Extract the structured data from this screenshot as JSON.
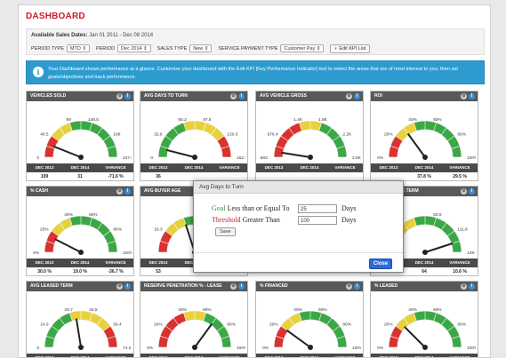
{
  "page": {
    "title": "DASHBOARD"
  },
  "filters": {
    "available_label": "Available Sales Dates:",
    "available_range": "Jan 01 2011 - Dec 08 2014",
    "period_type_label": "PERIOD TYPE",
    "period_type_value": "MTD",
    "period_label": "PERIOD",
    "period_value": "Dec 2014",
    "sales_type_label": "SALES TYPE",
    "sales_type_value": "New",
    "service_payment_type_label": "SERVICE PAYMENT TYPE",
    "service_payment_type_value": "Customer Pay",
    "edit_kpi_label": "Edit KPI List"
  },
  "info": {
    "icon": "info-icon",
    "text": "Your Dashboard shows performance at a glance. Customize your dashboard with the Edit KPI [Key Performance Indicator] tool to select the areas that are of most interest to you; then set goals/objectives and track performance."
  },
  "colors": {
    "accent": "#c8202b",
    "info_bg": "#2e9bcf",
    "header_bg": "#595959",
    "green": "#3aa845",
    "yellow": "#e8d13a",
    "red": "#d9322f"
  },
  "footer_labels": [
    "DEC 2013",
    "DEC 2014",
    "VARIANCE"
  ],
  "cards": [
    {
      "title": "VEHICLES SOLD",
      "ticks": [
        "0",
        "49.5",
        "99",
        "148.5",
        "198",
        "247.5"
      ],
      "tick_display": [
        "0",
        "49.5",
        "99",
        "148.5",
        "198",
        "247.5"
      ],
      "needle": 0.12,
      "scheme": "gyg",
      "values": [
        "109",
        "31",
        "-71.6 %"
      ]
    },
    {
      "title": "AVG DAYS TO TURN",
      "ticks": [
        "0",
        "32.6",
        "65.2",
        "97.8",
        "130.3",
        "162.9"
      ],
      "tick_display": [
        "0",
        "32.6",
        "65.2",
        "97.8",
        "130.3",
        "162.9"
      ],
      "needle": 0.08,
      "scheme": "gyr",
      "values": [
        "36",
        "",
        ""
      ]
    },
    {
      "title": "AVG VEHICLE GROSS",
      "ticks": [
        "583.",
        "976.4",
        "1.4K",
        "1.8K",
        "2.2K",
        "2.6K"
      ],
      "tick_display": [
        "583.",
        "976.4",
        "1.4K",
        "1.8K",
        "2.2K",
        "2.6K"
      ],
      "needle": 0.05,
      "scheme": "rg",
      "values": [
        "",
        "",
        ""
      ]
    },
    {
      "title": "ROI",
      "ticks": [
        "0%",
        "20%",
        "40%",
        "60%",
        "80%",
        "100%"
      ],
      "tick_display": [
        "0%",
        "20%",
        "40%",
        "60%",
        "80%",
        "100%"
      ],
      "needle": 0.3,
      "scheme": "ryg",
      "values": [
        "",
        "37.8 %",
        "29.5 %"
      ]
    },
    {
      "title": "% CASH",
      "ticks": [
        "0%",
        "20%",
        "40%",
        "60%",
        "80%",
        "100%"
      ],
      "tick_display": [
        "0%",
        "20%",
        "40%",
        "60%",
        "80%",
        "100%"
      ],
      "needle": 0.15,
      "scheme": "ryg",
      "values": [
        "30.0 %",
        "19.0 %",
        "-36.7 %"
      ]
    },
    {
      "title": "AVG BUYER AGE",
      "ticks": [
        "",
        "19.3",
        "",
        "",
        "",
        ""
      ],
      "tick_display": [
        "",
        "19.3",
        "",
        "",
        "",
        ""
      ],
      "needle": 0.4,
      "scheme": "gyg",
      "values": [
        "53",
        "",
        ""
      ]
    },
    {
      "title": "AVG FINANCE TERM",
      "ticks": [
        "",
        "",
        "",
        "83.8",
        "111.8",
        "139.7"
      ],
      "tick_display": [
        "",
        "",
        "",
        "83.8",
        "111.8",
        "139.7"
      ],
      "needle": 0.9,
      "scheme": "gyg",
      "values": [
        "",
        "64",
        "10.6 %"
      ]
    },
    {
      "title": "AVG LEASED TERM",
      "ticks": [
        "0",
        "14.9",
        "29.7",
        "44.5",
        "59.4",
        "74.2"
      ],
      "tick_display": [
        "0",
        "14.9",
        "29.7",
        "44.5",
        "59.4",
        "74.2"
      ],
      "needle": 0.45,
      "scheme": "gyr",
      "values": [
        "DEC 2013",
        "DEC 2014",
        "VARIANCE"
      ]
    },
    {
      "title": "RESERVE PENETRATION % - LEASE",
      "ticks": [
        "0%",
        "20%",
        "40%",
        "60%",
        "80%",
        "100%"
      ],
      "tick_display": [
        "0%",
        "20%",
        "40%",
        "60%",
        "80%",
        "100%"
      ],
      "needle": 0.7,
      "scheme": "rg",
      "values": [
        "DEC 2013",
        "DEC 2014",
        "VARIANCE"
      ]
    },
    {
      "title": "% FINANCED",
      "ticks": [
        "0%",
        "20%",
        "40%",
        "60%",
        "80%",
        "100%"
      ],
      "tick_display": [
        "0%",
        "20%",
        "40%",
        "60%",
        "80%",
        "100%"
      ],
      "needle": 0.2,
      "scheme": "ryg",
      "values": [
        "DEC 2013",
        "DEC 2014",
        "VARIANCE"
      ]
    },
    {
      "title": "% LEASED",
      "ticks": [
        "0%",
        "20%",
        "40%",
        "60%",
        "80%",
        "100%"
      ],
      "tick_display": [
        "0%",
        "20%",
        "40%",
        "60%",
        "80%",
        "100%"
      ],
      "needle": 0.25,
      "scheme": "ryg",
      "values": [
        "DEC 2013",
        "DEC 2014",
        "VARIANCE"
      ]
    }
  ],
  "modal": {
    "title": "Avg Days to Turn",
    "goal_word": "Goal",
    "goal_text": "Less than or Equal To",
    "goal_value": "25",
    "goal_unit": "Days",
    "threshold_word": "Threshold",
    "threshold_text": "Greater Than",
    "threshold_value": "100",
    "threshold_unit": "Days",
    "save_label": "Save",
    "close_label": "Close"
  }
}
